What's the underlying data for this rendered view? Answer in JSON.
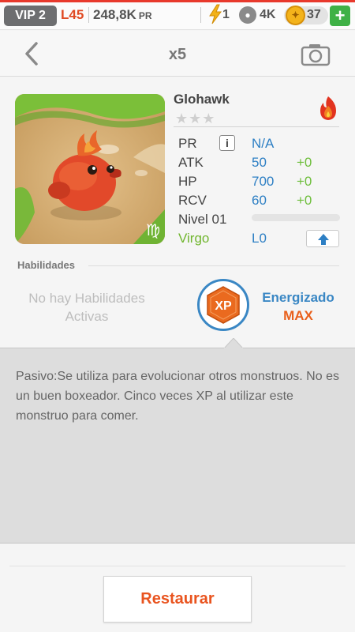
{
  "topbar": {
    "vip": "VIP 2",
    "level": "L45",
    "power_value": "248,8K",
    "power_unit": "PR",
    "energy": "1",
    "pawprints": "4K",
    "coins": "37",
    "add_icon": "+"
  },
  "nav": {
    "title": "x5",
    "back_icon": "chevron-left-icon",
    "camera_icon": "camera-icon"
  },
  "monster": {
    "name": "Glohawk",
    "element_icon": "fire-icon",
    "stars": "★★★",
    "star_count": 3,
    "stats": {
      "pr_label": "PR",
      "pr_info": "i",
      "pr_value": "N/A",
      "atk_label": "ATK",
      "atk_value": "50",
      "atk_bonus": "+0",
      "hp_label": "HP",
      "hp_value": "700",
      "hp_bonus": "+0",
      "rcv_label": "RCV",
      "rcv_value": "60",
      "rcv_bonus": "+0",
      "level_label": "Nivel 01",
      "level_progress": 0,
      "sign": "Virgo",
      "sign_glyph": "♍",
      "limit": "L0"
    }
  },
  "skills": {
    "header": "Habilidades",
    "none_text": "No hay Habilidades Activas",
    "badge_text": "XP",
    "energized_label": "Energizado",
    "energized_value": "MAX"
  },
  "description": "Pasivo:Se utiliza para evolucionar otros monstruos. No es un buen boxeador. Cinco veces XP al utilizar este monstruo para comer.",
  "restore_button": "Restaurar",
  "colors": {
    "accent_orange": "#e9541f",
    "stat_blue": "#2d7fc4",
    "bonus_green": "#6ebe3c",
    "coin_gold": "#f3b31b",
    "plus_green": "#3fb146"
  }
}
